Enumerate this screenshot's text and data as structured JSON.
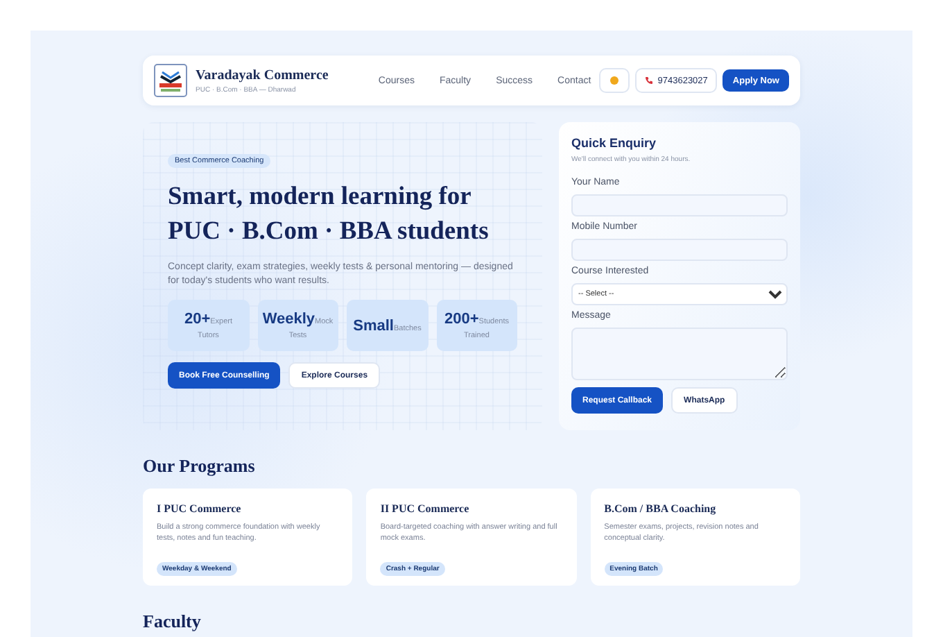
{
  "header": {
    "brand": "Varadayak Commerce",
    "tagline": "PUC · B.Com · BBA — Dharwad",
    "nav": [
      "Courses",
      "Faculty",
      "Success",
      "Contact"
    ],
    "phone": "9743623027",
    "cta": "Apply Now"
  },
  "hero": {
    "badge": "Best Commerce Coaching",
    "title": "Smart, modern learning for PUC · B.Com · BBA students",
    "subtitle": "Concept clarity, exam strategies, weekly tests & personal mentoring — designed for today's students who want results.",
    "stats": [
      {
        "value": "20+",
        "unit": "Expert",
        "label": "Tutors"
      },
      {
        "value": "Weekly",
        "unit": "Mock",
        "label": "Tests"
      },
      {
        "value": "Small",
        "unit": "Batches"
      },
      {
        "value": "200+",
        "unit": "Students",
        "label": "Trained"
      }
    ],
    "buttons": [
      {
        "label": "Book Free Counselling",
        "kind": "primary"
      },
      {
        "label": "Explore Courses",
        "kind": "secondary"
      }
    ]
  },
  "enquiry": {
    "title": "Quick Enquiry",
    "subtitle": "We'll connect with you within 24 hours.",
    "fields": [
      {
        "label": "Your Name",
        "kind": "text"
      },
      {
        "label": "Mobile Number",
        "kind": "text"
      },
      {
        "label": "Course Interested",
        "kind": "select",
        "value": "-- Select --"
      },
      {
        "label": "Message",
        "kind": "textarea"
      }
    ],
    "buttons": [
      {
        "label": "Request Callback",
        "kind": "primary"
      },
      {
        "label": "WhatsApp",
        "kind": "secondary"
      }
    ]
  },
  "programs": {
    "heading": "Our Programs",
    "cards": [
      {
        "title": "I PUC Commerce",
        "text": "Build a strong commerce foundation with weekly tests, notes and fun teaching.",
        "tag": "Weekday & Weekend"
      },
      {
        "title": "II PUC Commerce",
        "text": "Board-targeted coaching with answer writing and full mock exams.",
        "tag": "Crash + Regular"
      },
      {
        "title": "B.Com / BBA Coaching",
        "text": "Semester exams, projects, revision notes and conceptual clarity.",
        "tag": "Evening Batch"
      }
    ]
  },
  "faculty": {
    "heading": "Faculty"
  }
}
